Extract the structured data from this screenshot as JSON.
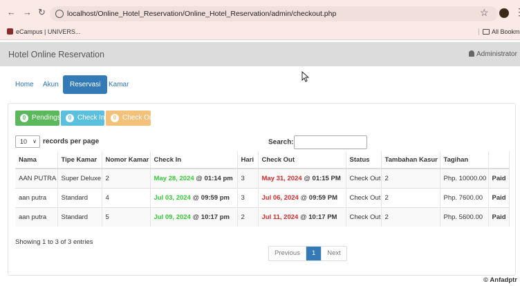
{
  "browser": {
    "url": "localhost/Online_Hotel_Reservation/Online_Hotel_Reservation/admin/checkout.php",
    "bookmark_1": "eCampus | UNIVERS...",
    "all_bookmarks": "All Bookmarks"
  },
  "header": {
    "brand": "Hotel Online Reservation",
    "user": "Administrator"
  },
  "nav": {
    "tabs": [
      {
        "label": "Home"
      },
      {
        "label": "Akun"
      },
      {
        "label": "Reservasi"
      },
      {
        "label": "Kamar"
      }
    ],
    "active": "Reservasi"
  },
  "status_buttons": [
    {
      "count": "0",
      "label": "Pendings"
    },
    {
      "count": "0",
      "label": "Check In"
    },
    {
      "count": "0",
      "label": "Check Out"
    }
  ],
  "table_controls": {
    "page_length": "10",
    "page_length_suffix": "records per page",
    "search_label": "Search:",
    "search_value": ""
  },
  "table": {
    "columns": [
      "Nama",
      "Tipe Kamar",
      "Nomor Kamar",
      "Check In",
      "Hari",
      "Check Out",
      "Status",
      "Tambahan Kasur",
      "Tagihan",
      ""
    ],
    "rows": [
      {
        "nama": "AAN PUTRA",
        "tipe": "Super Deluxe",
        "nomor": "2",
        "checkin_date": "May 28, 2024",
        "checkin_time": "01:14 pm",
        "hari": "3",
        "checkout_date": "May 31, 2024",
        "checkout_time": "01:15 PM",
        "status": "Check Out",
        "kasur": "2",
        "tagihan": "Php. 10000.00",
        "paid": "Paid"
      },
      {
        "nama": "aan putra",
        "tipe": "Standard",
        "nomor": "4",
        "checkin_date": "Jul 03, 2024",
        "checkin_time": "09:59 pm",
        "hari": "3",
        "checkout_date": "Jul 06, 2024",
        "checkout_time": "09:59 PM",
        "status": "Check Out",
        "kasur": "2",
        "tagihan": "Php. 7600.00",
        "paid": "Paid"
      },
      {
        "nama": "aan putra",
        "tipe": "Standard",
        "nomor": "5",
        "checkin_date": "Jul 09, 2024",
        "checkin_time": "10:17 pm",
        "hari": "2",
        "checkout_date": "Jul 11, 2024",
        "checkout_time": "10:17 PM",
        "status": "Check Out",
        "kasur": "2",
        "tagihan": "Php. 5600.00",
        "paid": "Paid"
      }
    ],
    "at": "@"
  },
  "pagination": {
    "info": "Showing 1 to 3 of 3 entries",
    "previous": "Previous",
    "current": "1",
    "next": "Next"
  },
  "footer": {
    "credit": "© Anfadptr"
  },
  "colors": {
    "primary": "#337ab7",
    "success": "#5cb85c",
    "info": "#5bc0de",
    "warning": "#f0ad4e",
    "checkin_date": "#37c837",
    "checkout_date": "#d42a2a"
  }
}
